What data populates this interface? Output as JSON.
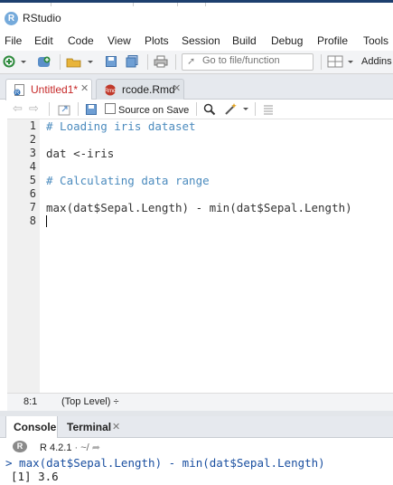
{
  "app": {
    "title": "RStudio",
    "logo_letter": "R"
  },
  "menu": [
    "File",
    "Edit",
    "Code",
    "View",
    "Plots",
    "Session",
    "Build",
    "Debug",
    "Profile",
    "Tools"
  ],
  "toolbar": {
    "goto_placeholder": "Go to file/function",
    "addins_label": "Addins"
  },
  "editor_tabs": [
    {
      "label": "Untitled1*",
      "active": true,
      "modified": true
    },
    {
      "label": "rcode.Rmd",
      "active": false,
      "modified": false
    }
  ],
  "editor_toolbar": {
    "source_on_save_label": "Source on Save",
    "source_on_save_checked": false
  },
  "editor": {
    "line_numbers": [
      "1",
      "2",
      "3",
      "4",
      "5",
      "6",
      "7",
      "8"
    ],
    "lines": [
      "# Loading iris dataset",
      "",
      "dat <-iris",
      "",
      "# Calculating data range",
      "",
      "max(dat$Sepal.Length) - min(dat$Sepal.Length)",
      ""
    ]
  },
  "status": {
    "cursor_position": "8:1",
    "scope": "(Top Level) ÷"
  },
  "console": {
    "tabs": [
      {
        "label": "Console",
        "active": true
      },
      {
        "label": "Terminal",
        "active": false
      }
    ],
    "r_version": "R 4.2.1",
    "working_dir": "· ~/",
    "lines": [
      "> max(dat$Sepal.Length) - min(dat$Sepal.Length)",
      "[1] 3.6"
    ]
  },
  "colors": {
    "accent": "#75aadb",
    "comment": "#4b8bbe",
    "modified_tab": "#c62828",
    "console_input": "#1a4fa0"
  }
}
